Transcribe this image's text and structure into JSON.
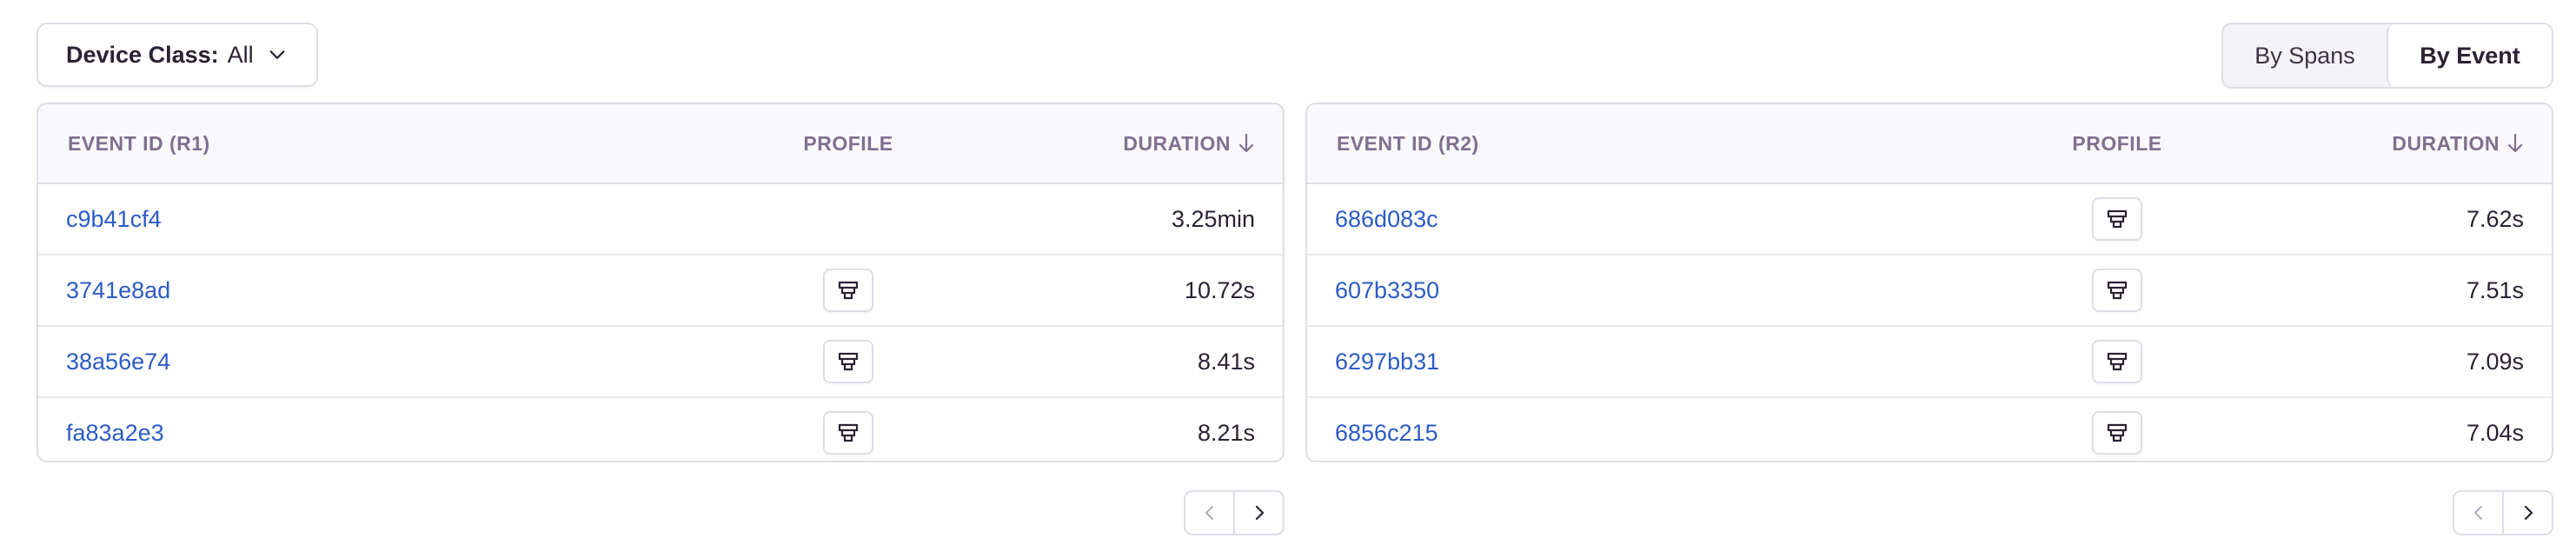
{
  "filter": {
    "label": "Device Class:",
    "value": "All"
  },
  "view_toggle": {
    "options": [
      "By Spans",
      "By Event"
    ],
    "selected": "By Event"
  },
  "tables": [
    {
      "columns": {
        "id": "EVENT ID (R1)",
        "profile": "PROFILE",
        "duration": "DURATION"
      },
      "sort": "duration-descending",
      "rows": [
        {
          "id": "c9b41cf4",
          "has_profile": false,
          "duration": "3.25min"
        },
        {
          "id": "3741e8ad",
          "has_profile": true,
          "duration": "10.72s"
        },
        {
          "id": "38a56e74",
          "has_profile": true,
          "duration": "8.41s"
        },
        {
          "id": "fa83a2e3",
          "has_profile": true,
          "duration": "8.21s"
        }
      ]
    },
    {
      "columns": {
        "id": "EVENT ID (R2)",
        "profile": "PROFILE",
        "duration": "DURATION"
      },
      "sort": "duration-descending",
      "rows": [
        {
          "id": "686d083c",
          "has_profile": true,
          "duration": "7.62s"
        },
        {
          "id": "607b3350",
          "has_profile": true,
          "duration": "7.51s"
        },
        {
          "id": "6297bb31",
          "has_profile": true,
          "duration": "7.09s"
        },
        {
          "id": "6856c215",
          "has_profile": true,
          "duration": "7.04s"
        }
      ]
    }
  ],
  "icons": {
    "profile": "profiling-icon",
    "sort": "arrow-down-icon",
    "prev": "chevron-left-icon",
    "next": "chevron-right-icon"
  },
  "colors": {
    "link": "#2c5cc5",
    "header_text": "#80708f",
    "border": "#e0dce5"
  }
}
